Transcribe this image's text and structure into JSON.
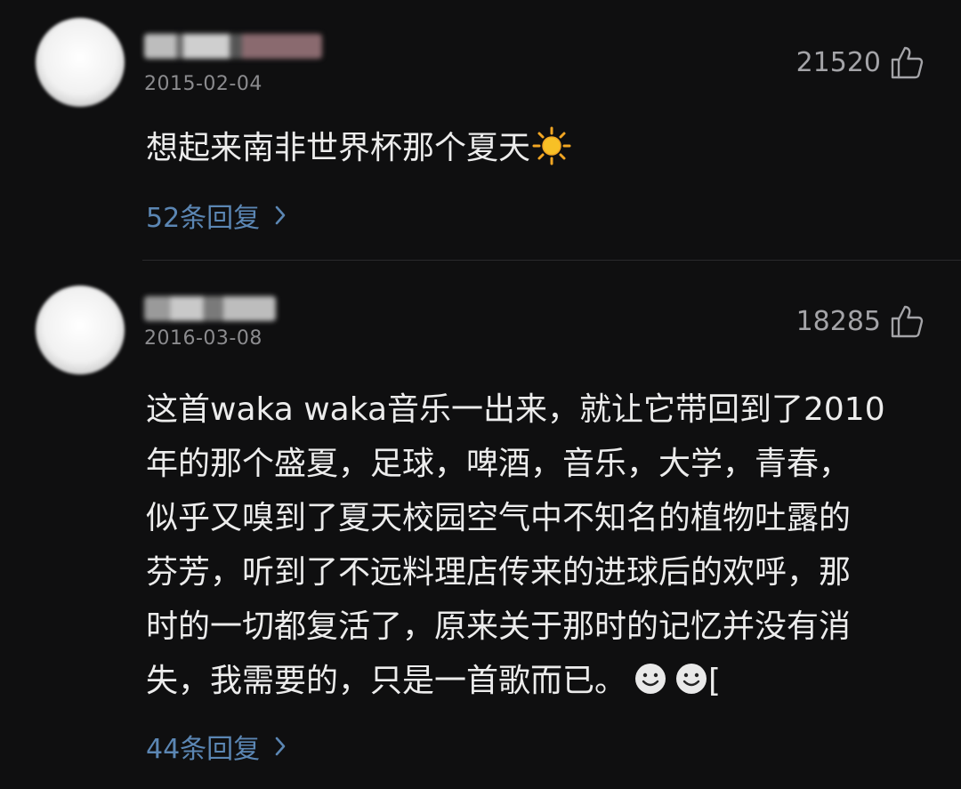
{
  "comments": [
    {
      "date": "2015-02-04",
      "likes": "21520",
      "text": "想起来南非世界杯那个夏天",
      "emoji": "sun-icon",
      "replies": "52条回复"
    },
    {
      "date": "2016-03-08",
      "likes": "18285",
      "lines": [
        "这首waka waka音乐一出来，就让它带回到了2010",
        "年的那个盛夏，足球，啤酒，音乐，大学，青春，",
        "似乎又嗅到了夏天校园空气中不知名的植物吐露的",
        "芬芳，听到了不远料理店传来的进球后的欢呼，那",
        "时的一切都复活了，原来关于那时的记忆并没有消",
        "失，我需要的，只是一首歌而已。"
      ],
      "trailing_text": "[",
      "emoji": "smile-icon",
      "replies": "44条回复"
    }
  ],
  "colors": {
    "background": "#0f0f10",
    "reply_link": "#5b86b3",
    "meta": "#8b8b8e"
  }
}
